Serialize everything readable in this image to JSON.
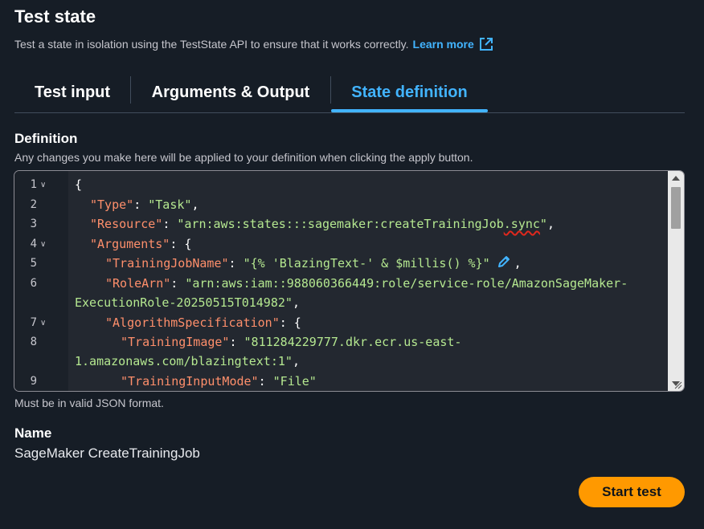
{
  "header": {
    "title": "Test state",
    "subtitle": "Test a state in isolation using the TestState API to ensure that it works correctly.",
    "learn_more": "Learn more",
    "link_icon": "external-link-icon"
  },
  "tabs": [
    {
      "label": "Test input",
      "active": false
    },
    {
      "label": "Arguments & Output",
      "active": false
    },
    {
      "label": "State definition",
      "active": true
    }
  ],
  "definition": {
    "label": "Definition",
    "description": "Any changes you make here will be applied to your definition when clicking the apply button.",
    "hint": "Must be in valid JSON format.",
    "line_numbers": [
      "1",
      "2",
      "3",
      "4",
      "5",
      "6",
      "7",
      "8",
      "9"
    ],
    "code": {
      "l1_brace": "{",
      "type_key": "\"Type\"",
      "type_val": "\"Task\"",
      "resource_key": "\"Resource\"",
      "resource_val_a": "\"arn:aws:states:::sagemaker:createTrainingJob",
      "resource_val_b": ".sync",
      "resource_val_c": "\"",
      "arguments_key": "\"Arguments\"",
      "job_name_key": "\"TrainingJobName\"",
      "job_name_val": "\"{% 'BlazingText-' & $millis() %}\"",
      "role_key": "\"RoleArn\"",
      "role_val_a": "\"arn:aws:iam::988060366449:role/service-role/AmazonSageMaker-",
      "role_val_b": "ExecutionRole-20250515T014982\"",
      "algo_key": "\"AlgorithmSpecification\"",
      "image_key": "\"TrainingImage\"",
      "image_val_a": "\"811284229777.dkr.ecr.us-east-",
      "image_val_b": "1.amazonaws.com/blazingtext:1\"",
      "mode_key": "\"TrainingInputMode\"",
      "mode_val": "\"File\""
    }
  },
  "name": {
    "label": "Name",
    "value": "SageMaker CreateTrainingJob"
  },
  "actions": {
    "start_test": "Start test"
  },
  "colors": {
    "background": "#161d26",
    "accent": "#42b4ff",
    "primary_button": "#ff9900",
    "json_key": "#ff8f6b",
    "json_string": "#b5e890",
    "error_squiggle": "#e0281d"
  }
}
